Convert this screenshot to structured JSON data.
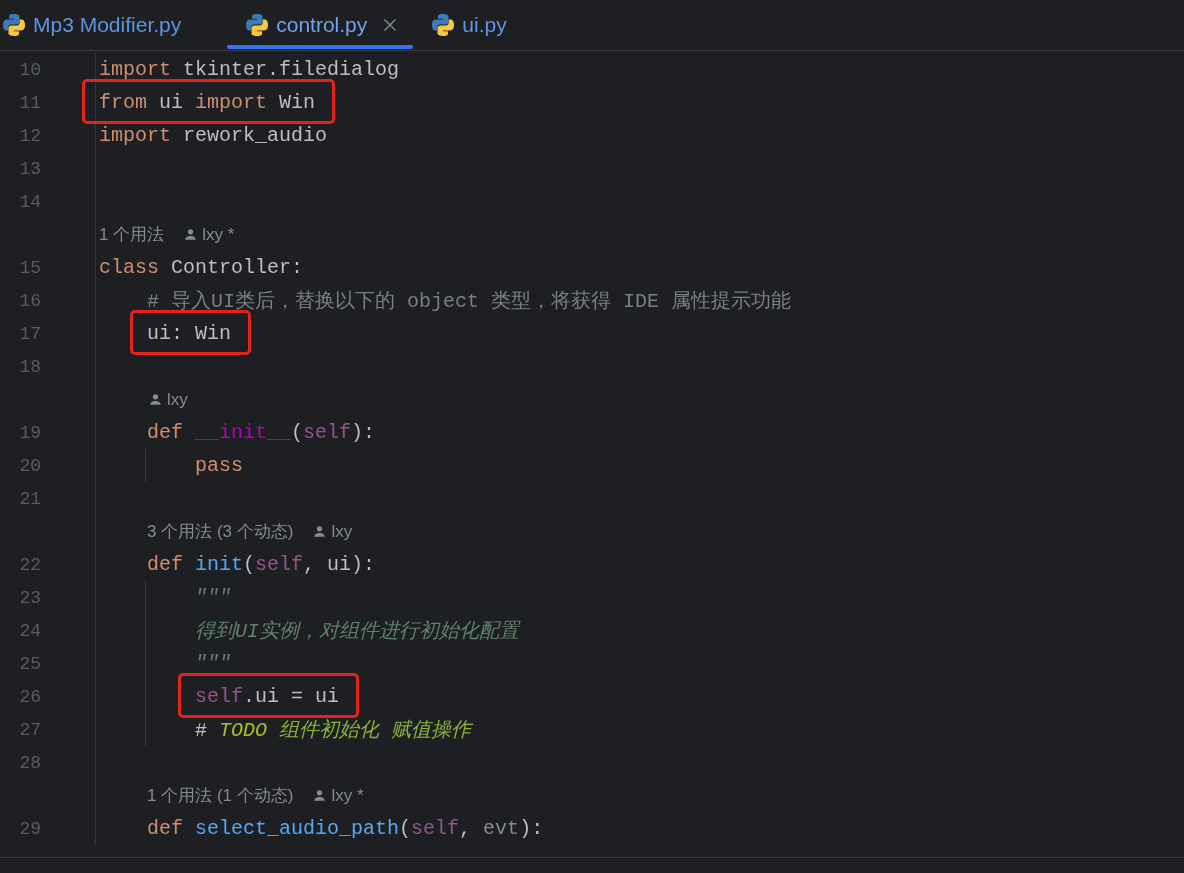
{
  "tabs": [
    {
      "label": "Mp3 Modifier.py",
      "selected": false
    },
    {
      "label": "control.py",
      "selected": true
    },
    {
      "label": "ui.py",
      "selected": false
    }
  ],
  "editor": {
    "lines": [
      {
        "kind": "code",
        "number": "10",
        "highlighted": false,
        "tokens": [
          {
            "kind": "keyword",
            "text": "import"
          },
          {
            "kind": "plain",
            "text": " tkinter.filedialog"
          }
        ]
      },
      {
        "kind": "code",
        "number": "11",
        "highlighted": true,
        "tokens": [
          {
            "kind": "keyword",
            "text": "from"
          },
          {
            "kind": "plain",
            "text": " ui "
          },
          {
            "kind": "keyword",
            "text": "import"
          },
          {
            "kind": "plain",
            "text": " Win"
          }
        ]
      },
      {
        "kind": "code",
        "number": "12",
        "highlighted": false,
        "tokens": [
          {
            "kind": "keyword",
            "text": "import"
          },
          {
            "kind": "plain",
            "text": " rework_audio"
          }
        ]
      },
      {
        "kind": "code",
        "number": "13",
        "highlighted": false
      },
      {
        "kind": "code",
        "number": "14",
        "highlighted": false
      },
      {
        "kind": "hint",
        "usages": "1 个用法",
        "author": "lxy *"
      },
      {
        "kind": "code",
        "number": "15",
        "highlighted": false,
        "tokens": [
          {
            "kind": "keyword",
            "text": "class"
          },
          {
            "kind": "plain",
            "text": " Controller:"
          }
        ],
        "children": [
          {
            "kind": "code",
            "number": "16",
            "highlighted": false,
            "tokens": [
              {
                "kind": "comment",
                "text": "# 导入UI类后，替换以下的 object 类型，将获得 IDE 属性提示功能"
              }
            ]
          },
          {
            "kind": "code",
            "number": "17",
            "highlighted": true,
            "tokens": [
              {
                "kind": "plain",
                "text": "ui: Win"
              }
            ]
          },
          {
            "kind": "code",
            "number": "18",
            "highlighted": false
          },
          {
            "kind": "hint",
            "author": "lxy"
          },
          {
            "kind": "code",
            "number": "19",
            "highlighted": false,
            "tokens": [
              {
                "kind": "keyword",
                "text": "def "
              },
              {
                "kind": "magic",
                "text": "__init__"
              },
              {
                "kind": "plain",
                "text": "("
              },
              {
                "kind": "self",
                "text": "self"
              },
              {
                "kind": "plain",
                "text": "):"
              }
            ],
            "children": [
              {
                "kind": "code",
                "number": "20",
                "highlighted": false,
                "tokens": [
                  {
                    "kind": "keyword",
                    "text": "pass"
                  }
                ]
              }
            ]
          },
          {
            "kind": "code",
            "number": "21",
            "highlighted": false
          },
          {
            "kind": "hint",
            "usages": "3 个用法 (3 个动态)",
            "author": "lxy"
          },
          {
            "kind": "code",
            "number": "22",
            "highlighted": false,
            "tokens": [
              {
                "kind": "keyword",
                "text": "def "
              },
              {
                "kind": "function",
                "text": "init"
              },
              {
                "kind": "plain",
                "text": "("
              },
              {
                "kind": "self",
                "text": "self"
              },
              {
                "kind": "plain",
                "text": ", ui):"
              }
            ],
            "children": [
              {
                "kind": "code",
                "number": "23",
                "highlighted": false,
                "tokens": [
                  {
                    "kind": "docstring",
                    "text": "\"\"\""
                  }
                ]
              },
              {
                "kind": "code",
                "number": "24",
                "highlighted": false,
                "tokens": [
                  {
                    "kind": "docstring",
                    "text": "得到UI实例，对组件进行初始化配置"
                  }
                ]
              },
              {
                "kind": "code",
                "number": "25",
                "highlighted": false,
                "tokens": [
                  {
                    "kind": "docstring",
                    "text": "\"\"\""
                  }
                ]
              },
              {
                "kind": "code",
                "number": "26",
                "highlighted": true,
                "tokens": [
                  {
                    "kind": "self",
                    "text": "self"
                  },
                  {
                    "kind": "plain",
                    "text": ".ui = ui"
                  }
                ]
              },
              {
                "kind": "code",
                "number": "27",
                "highlighted": false,
                "tokens": [
                  {
                    "kind": "plain",
                    "text": "# "
                  },
                  {
                    "kind": "todo",
                    "text": "TODO"
                  },
                  {
                    "kind": "todo_text",
                    "text": " 组件初始化 赋值操作"
                  }
                ]
              }
            ]
          },
          {
            "kind": "code",
            "number": "28",
            "highlighted": false
          },
          {
            "kind": "hint",
            "usages": "1 个用法 (1 个动态)",
            "author": "lxy *"
          },
          {
            "kind": "code",
            "number": "29",
            "highlighted": false,
            "tokens": [
              {
                "kind": "keyword",
                "text": "def "
              },
              {
                "kind": "function",
                "text": "select_audio_path"
              },
              {
                "kind": "plain",
                "text": "("
              },
              {
                "kind": "self",
                "text": "self"
              },
              {
                "kind": "plain",
                "text": ", "
              },
              {
                "kind": "unused",
                "text": "evt"
              },
              {
                "kind": "plain",
                "text": "):"
              }
            ]
          }
        ]
      }
    ]
  }
}
